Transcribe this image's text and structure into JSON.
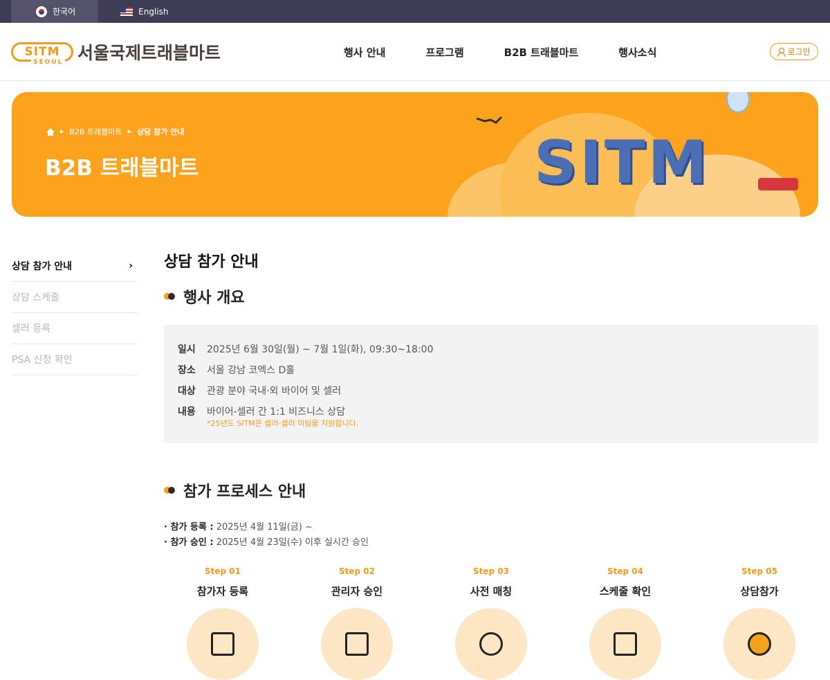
{
  "lang": {
    "korean": "한국어",
    "english": "English"
  },
  "header": {
    "logo_mark": "SITM",
    "logo_sub": "SEOUL",
    "logo_text": "서울국제트래블마트",
    "nav": [
      "행사 안내",
      "프로그램",
      "B2B 트래블마트",
      "행사소식"
    ],
    "login": "로그인"
  },
  "banner": {
    "breadcrumb": [
      "B2B 트래블마트",
      "상담 참가 안내"
    ],
    "title": "B2B 트래블마트",
    "art_text": "SITM"
  },
  "sidebar": {
    "items": [
      "상담 참가 안내",
      "상담 스케줄",
      "셀러 등록",
      "PSA 신청 확인"
    ]
  },
  "content": {
    "page_title": "상담 참가 안내",
    "overview_title": "행사 개요",
    "overview": [
      {
        "label": "일시",
        "value": "2025년 6월 30일(월) ~ 7월 1일(화), 09:30~18:00"
      },
      {
        "label": "장소",
        "value": "서울 강남 코엑스 D홀"
      },
      {
        "label": "대상",
        "value": "관광 분야 국내·외 바이어 및 셀러"
      },
      {
        "label": "내용",
        "value": "바이어-셀러 간 1:1 비즈니스 상담"
      }
    ],
    "overview_note": "*25년도 SITM은 셀러-셀러 미팅을 지원합니다.",
    "process_title": "참가 프로세스 안내",
    "process_register_label": "· 참가 등록 :",
    "process_register_value": " 2025년 4월 11일(금) ~",
    "process_approve_label": "· 참가 승인 :",
    "process_approve_value": " 2025년 4월 23일(수) 이후 실시간 승인",
    "steps": [
      {
        "num": "Step 01",
        "name": "참가자 등록"
      },
      {
        "num": "Step 02",
        "name": "관리자 승인"
      },
      {
        "num": "Step 03",
        "name": "사전 매칭"
      },
      {
        "num": "Step 04",
        "name": "스케줄 확인"
      },
      {
        "num": "Step 05",
        "name": "상담참가"
      }
    ]
  },
  "colors": {
    "accent": "#f29b18",
    "banner": "#fca21c",
    "topbar": "#3f3d56"
  }
}
